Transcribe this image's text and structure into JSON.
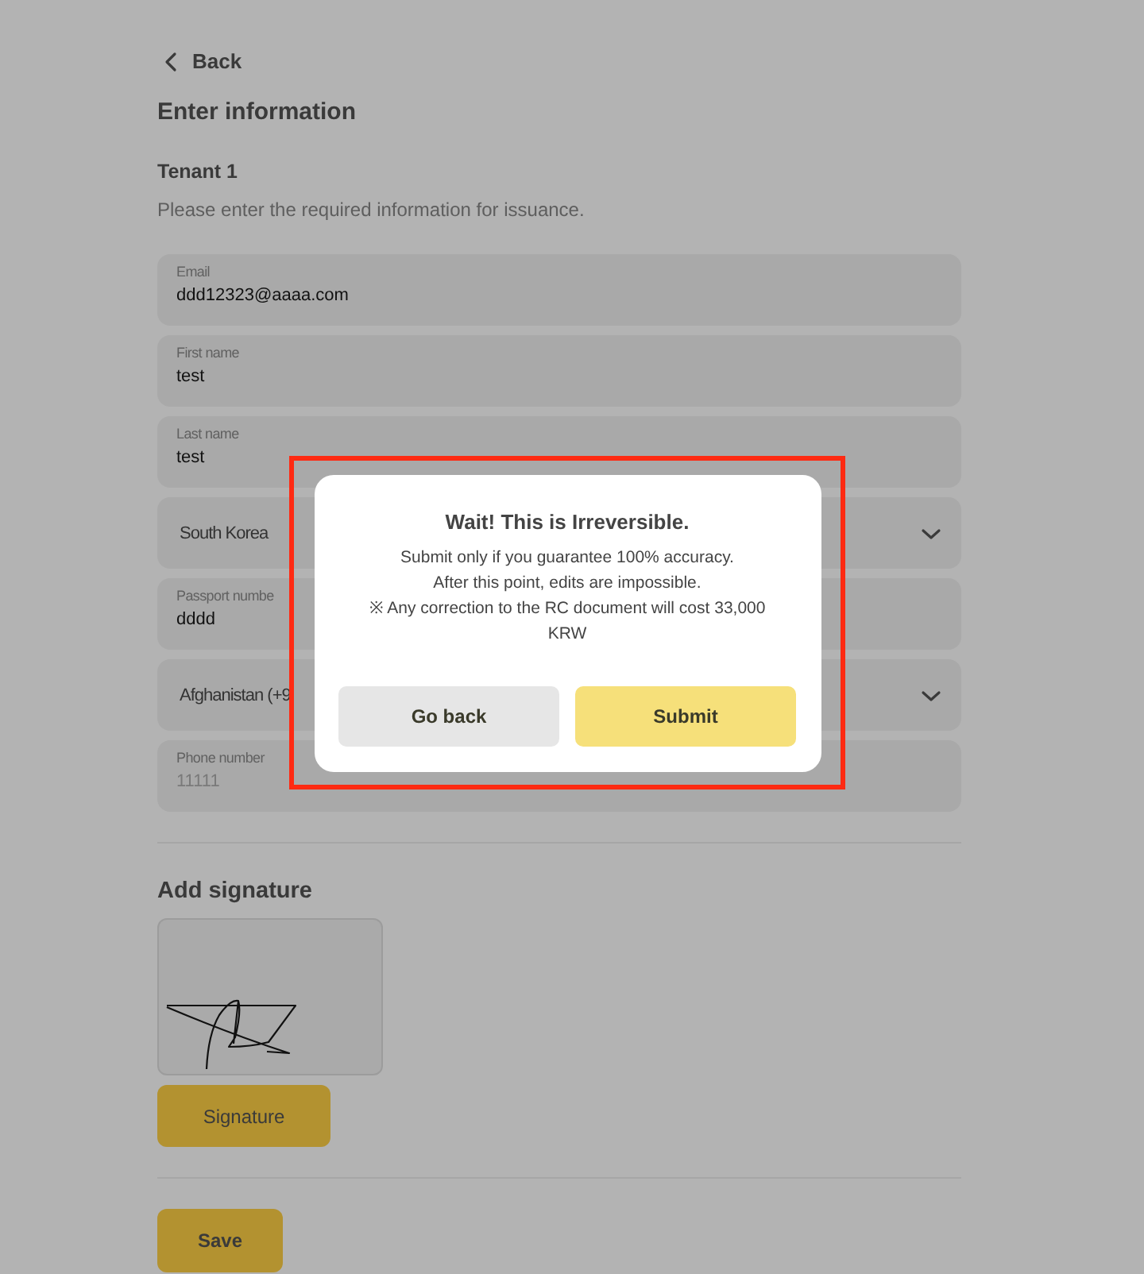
{
  "back": {
    "label": "Back"
  },
  "title": "Enter information",
  "section": {
    "title": "Tenant 1",
    "description": "Please enter the required information for issuance."
  },
  "fields": [
    {
      "kind": "text",
      "label": "Email",
      "value": "ddd12323@aaaa.com"
    },
    {
      "kind": "text",
      "label": "First name",
      "value": "test"
    },
    {
      "kind": "text",
      "label": "Last name",
      "value": "test"
    },
    {
      "kind": "select",
      "value": "South Korea"
    },
    {
      "kind": "text",
      "label": "Passport numbe",
      "value": "dddd"
    },
    {
      "kind": "select",
      "value": "Afghanistan (+9"
    },
    {
      "kind": "text",
      "label": "Phone number",
      "placeholder": "11111"
    }
  ],
  "signature": {
    "title": "Add signature",
    "button": "Signature"
  },
  "save_button": "Save",
  "dialog": {
    "title": "Wait! This is Irreversible.",
    "message_lines": [
      "Submit only if you guarantee 100% accuracy.",
      "After this point, edits are impossible.",
      "※ Any correction to the RC document will cost 33,000 KRW"
    ],
    "buttons": [
      {
        "label": "Go back",
        "kind": "secondary"
      },
      {
        "label": "Submit",
        "kind": "primary"
      }
    ]
  }
}
